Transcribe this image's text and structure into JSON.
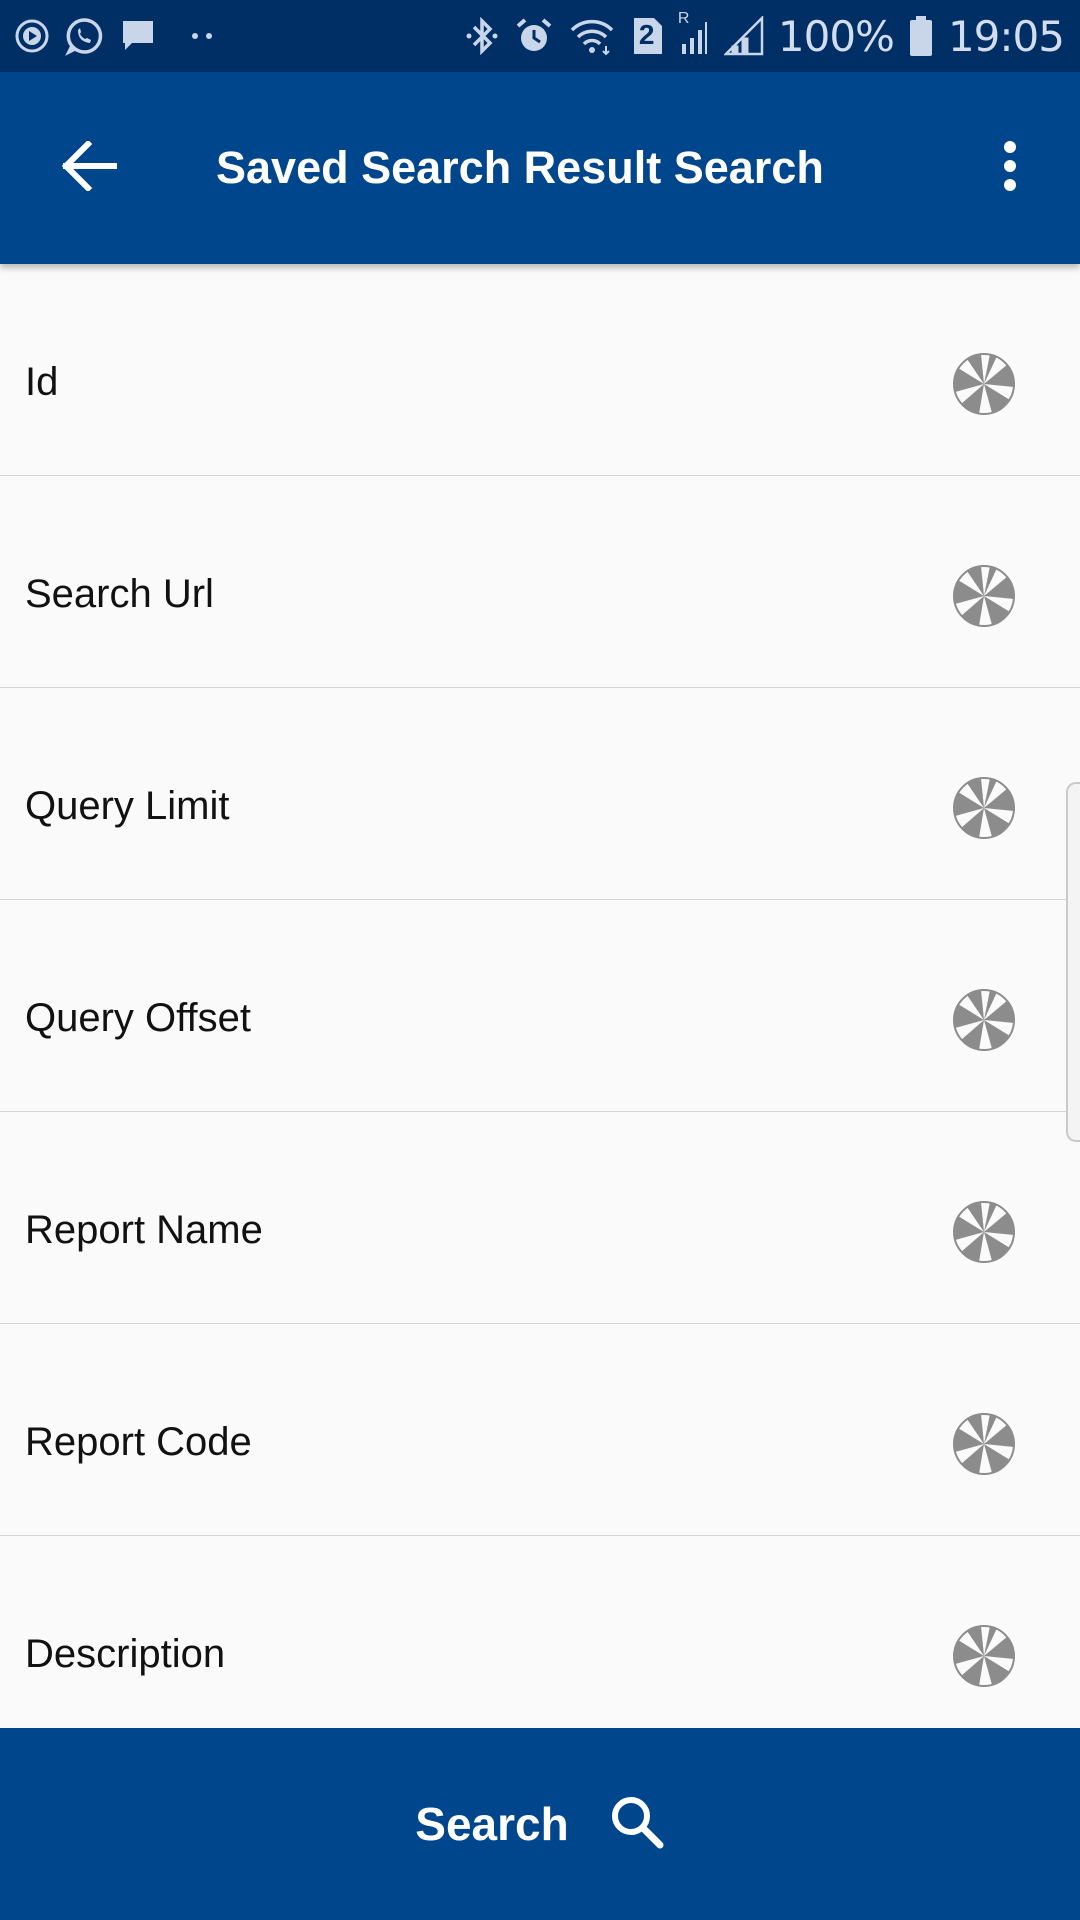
{
  "status_bar": {
    "battery": "100%",
    "time": "19:05",
    "sim_badge": "2",
    "roaming": "R",
    "left_icons": [
      "play-icon",
      "whatsapp-icon",
      "message-icon",
      "more-dots-icon"
    ],
    "right_icons": [
      "bluetooth-icon",
      "alarm-icon",
      "wifi-icon",
      "sim-icon",
      "signal-icon",
      "battery-icon"
    ]
  },
  "app_bar": {
    "title": "Saved Search Result Search",
    "back_icon": "arrow-back-icon",
    "menu_icon": "more-vert-icon"
  },
  "fields": [
    {
      "label": "Id",
      "icon": "aperture-icon"
    },
    {
      "label": "Search Url",
      "icon": "aperture-icon"
    },
    {
      "label": "Query Limit",
      "icon": "aperture-icon"
    },
    {
      "label": "Query Offset",
      "icon": "aperture-icon"
    },
    {
      "label": "Report Name",
      "icon": "aperture-icon"
    },
    {
      "label": "Report Code",
      "icon": "aperture-icon"
    },
    {
      "label": "Description",
      "icon": "aperture-icon"
    }
  ],
  "search_button": {
    "label": "Search",
    "icon": "search-icon"
  },
  "colors": {
    "status_bar": "#002f66",
    "primary": "#00468c",
    "background": "#fafafa",
    "divider": "#d4d4d4",
    "icon_gray": "#8c8c8c"
  }
}
